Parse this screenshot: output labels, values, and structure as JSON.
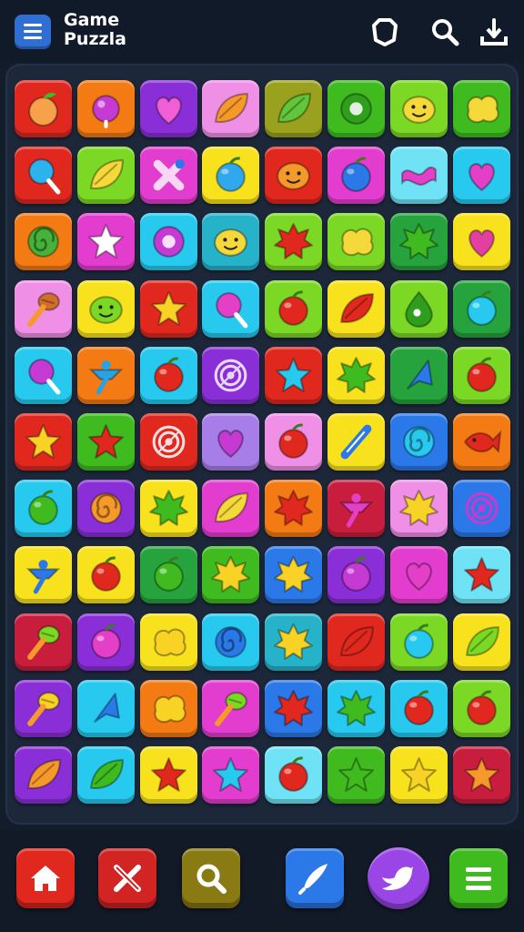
{
  "header": {
    "title_line1": "Game",
    "title_line2": "Puzzla",
    "menu_icon": "hamburger-menu-icon",
    "actions": [
      {
        "name": "shield-icon",
        "color": "#ffffff"
      },
      {
        "name": "search-icon",
        "color": "#ffffff"
      },
      {
        "name": "upload-icon",
        "color": "#ffffff"
      }
    ]
  },
  "palette": {
    "red": "#e0281f",
    "orange": "#f47a14",
    "purple": "#8a2fd8",
    "magenta": "#e23dcf",
    "olive": "#9aa11e",
    "green": "#3fbb20",
    "lime": "#7bd824",
    "yellow": "#f8e21d",
    "cyan": "#27c9ef",
    "pink": "#f08fe6",
    "blue": "#2b78e8",
    "lavender": "#a77ee8",
    "crimson": "#c81d3c",
    "teal": "#26b3c9",
    "darkgreen": "#26a33c",
    "lightcyan": "#6fe3f5"
  },
  "board": {
    "rows": [
      [
        {
          "bg": "red",
          "icon": "peach",
          "c": "#f7a14a"
        },
        {
          "bg": "orange",
          "icon": "berry",
          "c": "#c43ad2"
        },
        {
          "bg": "purple",
          "icon": "heart",
          "c": "#f05fd6"
        },
        {
          "bg": "pink",
          "icon": "leaf",
          "c": "#f59a2a"
        },
        {
          "bg": "olive",
          "icon": "leaf",
          "c": "#61c63a"
        },
        {
          "bg": "green",
          "icon": "donut",
          "c": "#2e9e1c"
        },
        {
          "bg": "lime",
          "icon": "smile",
          "c": "#f5d83a"
        },
        {
          "bg": "green",
          "icon": "blob",
          "c": "#f5d83a"
        }
      ],
      [
        {
          "bg": "red",
          "icon": "lollipop",
          "c": "#2cb3ee"
        },
        {
          "bg": "lime",
          "icon": "leaf",
          "c": "#f5d83a"
        },
        {
          "bg": "magenta",
          "icon": "cross",
          "c": "#f9d6f3"
        },
        {
          "bg": "yellow",
          "icon": "fruit",
          "c": "#2fa8ee"
        },
        {
          "bg": "red",
          "icon": "smile",
          "c": "#f59a2a"
        },
        {
          "bg": "magenta",
          "icon": "fruit",
          "c": "#2b78e8"
        },
        {
          "bg": "lightcyan",
          "icon": "wave",
          "c": "#e33fc7"
        },
        {
          "bg": "cyan",
          "icon": "heart",
          "c": "#e33fc7"
        }
      ],
      [
        {
          "bg": "orange",
          "icon": "swirl",
          "c": "#46b23a"
        },
        {
          "bg": "magenta",
          "icon": "star",
          "c": "#ffffff"
        },
        {
          "bg": "cyan",
          "icon": "donut",
          "c": "#c43ad2"
        },
        {
          "bg": "teal",
          "icon": "smile",
          "c": "#f5d83a"
        },
        {
          "bg": "lime",
          "icon": "burst",
          "c": "#e0281f"
        },
        {
          "bg": "lime",
          "icon": "blob",
          "c": "#f5d83a"
        },
        {
          "bg": "darkgreen",
          "icon": "burst",
          "c": "#3fbb20"
        },
        {
          "bg": "yellow",
          "icon": "heart",
          "c": "#e33fa0"
        }
      ],
      [
        {
          "bg": "pink",
          "icon": "rattle",
          "c": "#d26d2b"
        },
        {
          "bg": "yellow",
          "icon": "smile",
          "c": "#7bd824"
        },
        {
          "bg": "red",
          "icon": "star",
          "c": "#f8d224"
        },
        {
          "bg": "cyan",
          "icon": "lollipop",
          "c": "#e33fc7"
        },
        {
          "bg": "lime",
          "icon": "fruit",
          "c": "#e0281f"
        },
        {
          "bg": "yellow",
          "icon": "leaf",
          "c": "#e0281f"
        },
        {
          "bg": "lime",
          "icon": "drop",
          "c": "#2e9e1c"
        },
        {
          "bg": "darkgreen",
          "icon": "fruit",
          "c": "#27c9ef"
        }
      ],
      [
        {
          "bg": "cyan",
          "icon": "lollipop",
          "c": "#c43ad2"
        },
        {
          "bg": "orange",
          "icon": "spinner",
          "c": "#27a3e3"
        },
        {
          "bg": "cyan",
          "icon": "fruit",
          "c": "#e0281f"
        },
        {
          "bg": "purple",
          "icon": "target",
          "c": "#e8d8ff"
        },
        {
          "bg": "red",
          "icon": "star",
          "c": "#27c9ef"
        },
        {
          "bg": "yellow",
          "icon": "burst",
          "c": "#3fbb20"
        },
        {
          "bg": "darkgreen",
          "icon": "shard",
          "c": "#2b78e8"
        },
        {
          "bg": "lime",
          "icon": "fruit",
          "c": "#e0281f"
        }
      ],
      [
        {
          "bg": "red",
          "icon": "star",
          "c": "#f8d224"
        },
        {
          "bg": "green",
          "icon": "star",
          "c": "#e0281f"
        },
        {
          "bg": "red",
          "icon": "target",
          "c": "#f8e0e0"
        },
        {
          "bg": "lavender",
          "icon": "heart",
          "c": "#c43ad2"
        },
        {
          "bg": "pink",
          "icon": "fruit",
          "c": "#e0281f"
        },
        {
          "bg": "yellow",
          "icon": "wand",
          "c": "#2b78e8"
        },
        {
          "bg": "blue",
          "icon": "swirl",
          "c": "#27c9ef"
        },
        {
          "bg": "orange",
          "icon": "fish",
          "c": "#e0281f"
        }
      ],
      [
        {
          "bg": "cyan",
          "icon": "fruit",
          "c": "#3fbb20"
        },
        {
          "bg": "purple",
          "icon": "swirl",
          "c": "#f59a2a"
        },
        {
          "bg": "yellow",
          "icon": "burst",
          "c": "#3fbb20"
        },
        {
          "bg": "magenta",
          "icon": "leaf",
          "c": "#f5d83a"
        },
        {
          "bg": "orange",
          "icon": "burst",
          "c": "#e0281f"
        },
        {
          "bg": "crimson",
          "icon": "spinner",
          "c": "#e33fc7"
        },
        {
          "bg": "pink",
          "icon": "burst",
          "c": "#f8d224"
        },
        {
          "bg": "blue",
          "icon": "target",
          "c": "#c43ad2"
        }
      ],
      [
        {
          "bg": "yellow",
          "icon": "spinner",
          "c": "#2b78e8"
        },
        {
          "bg": "yellow",
          "icon": "fruit",
          "c": "#e0281f"
        },
        {
          "bg": "darkgreen",
          "icon": "fruit",
          "c": "#3fbb20"
        },
        {
          "bg": "green",
          "icon": "burst",
          "c": "#f8d224"
        },
        {
          "bg": "blue",
          "icon": "burst",
          "c": "#f8d224"
        },
        {
          "bg": "purple",
          "icon": "fruit",
          "c": "#c43ad2"
        },
        {
          "bg": "magenta",
          "icon": "heart",
          "c": "#e33fc7"
        },
        {
          "bg": "lightcyan",
          "icon": "star",
          "c": "#e0281f"
        }
      ],
      [
        {
          "bg": "crimson",
          "icon": "rattle",
          "c": "#7bd824"
        },
        {
          "bg": "purple",
          "icon": "fruit",
          "c": "#e33fc7"
        },
        {
          "bg": "yellow",
          "icon": "blob",
          "c": "#f8d224"
        },
        {
          "bg": "cyan",
          "icon": "swirl",
          "c": "#2b78e8"
        },
        {
          "bg": "teal",
          "icon": "burst",
          "c": "#f8d224"
        },
        {
          "bg": "red",
          "icon": "leaf",
          "c": "#e0281f"
        },
        {
          "bg": "lime",
          "icon": "fruit",
          "c": "#27c9ef"
        },
        {
          "bg": "yellow",
          "icon": "leaf",
          "c": "#7bd824"
        }
      ],
      [
        {
          "bg": "purple",
          "icon": "rattle",
          "c": "#f8d224"
        },
        {
          "bg": "cyan",
          "icon": "shard",
          "c": "#2b78e8"
        },
        {
          "bg": "orange",
          "icon": "blob",
          "c": "#f8d224"
        },
        {
          "bg": "magenta",
          "icon": "rattle",
          "c": "#7bd824"
        },
        {
          "bg": "blue",
          "icon": "burst",
          "c": "#e0281f"
        },
        {
          "bg": "cyan",
          "icon": "burst",
          "c": "#3fbb20"
        },
        {
          "bg": "cyan",
          "icon": "fruit",
          "c": "#e0281f"
        },
        {
          "bg": "lime",
          "icon": "fruit",
          "c": "#e0281f"
        }
      ],
      [
        {
          "bg": "purple",
          "icon": "leaf",
          "c": "#f59a2a"
        },
        {
          "bg": "cyan",
          "icon": "leaf",
          "c": "#3fbb20"
        },
        {
          "bg": "yellow",
          "icon": "star",
          "c": "#e0281f"
        },
        {
          "bg": "magenta",
          "icon": "star",
          "c": "#27c9ef"
        },
        {
          "bg": "lightcyan",
          "icon": "fruit",
          "c": "#e0281f"
        },
        {
          "bg": "green",
          "icon": "star",
          "c": "#3fbb20"
        },
        {
          "bg": "yellow",
          "icon": "star",
          "c": "#f8d224"
        },
        {
          "bg": "crimson",
          "icon": "star",
          "c": "#f59a2a"
        }
      ]
    ]
  },
  "bottom_bar": [
    {
      "name": "home-button",
      "icon": "home-icon",
      "bg": "#e0281f"
    },
    {
      "name": "tools-button",
      "icon": "tools-icon",
      "bg": "#d32424"
    },
    {
      "name": "search-button",
      "icon": "search-icon",
      "bg": "#8a7a14"
    },
    {
      "name": "rocket-button",
      "icon": "rocket-icon",
      "bg": "#2b78e8"
    },
    {
      "name": "bird-button",
      "icon": "bird-icon",
      "bg": "#9a46e6"
    },
    {
      "name": "menu-button",
      "icon": "menu-icon",
      "bg": "#3fbb20"
    }
  ]
}
